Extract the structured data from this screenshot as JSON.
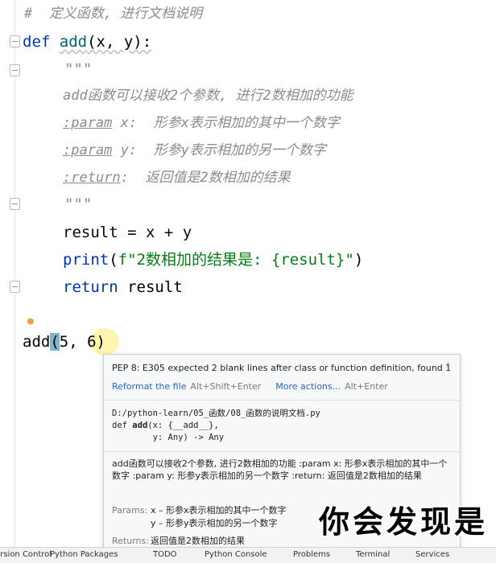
{
  "editor": {
    "comment": "#  定义函数, 进行文档说明",
    "def_kw": "def ",
    "func_name": "add",
    "def_params": "(x, y):",
    "doc_open": "\"\"\"",
    "doc_line1": "add函数可以接收2个参数, 进行2数相加的功能",
    "param_tag": ":param",
    "param_x": " x:  形参x表示相加的其中一个数字",
    "param_y": " y:  形参y表示相加的另一个数字",
    "return_tag": ":return",
    "return_text": ":  返回值是2数相加的结果",
    "doc_close": "\"\"\"",
    "body1": "result = x + y",
    "print_fn": "print",
    "print_open": "(",
    "print_str": "f\"2数相加的结果是: {result}\"",
    "print_close": ")",
    "return_kw": "return",
    "return_val": " result",
    "call_name": "add",
    "call_open": "(",
    "call_args": "5, 6",
    "call_close": ")"
  },
  "popup": {
    "warning": "PEP 8: E305 expected 2 blank lines after class or function definition, found 1",
    "reformat_label": "Reformat the file",
    "reformat_shortcut": "Alt+Shift+Enter",
    "more_label": "More actions...",
    "more_shortcut": "Alt+Enter",
    "path": "D:/python-learn/05_函数/08_函数的说明文档.py",
    "sig_def": "def ",
    "sig_name": "add",
    "sig_line1_rest": "(x: {__add__},",
    "sig_line2": "        y: Any) -> Any",
    "description": "add函数可以接收2个参数, 进行2数相加的功能 :param x: 形参x表示相加的其中一个数字 :param y: 形参y表示相加的另一个数字 :return: 返回值是2数相加的结果",
    "params_label": "Params:",
    "param_x_doc": "x – 形参x表示相加的其中一个数字",
    "param_y_doc": "y – 形参y表示相加的另一个数字",
    "returns_label": "Returns:",
    "returns_doc": "返回值是2数相加的结果"
  },
  "subtitle": "你会发现是",
  "statusbar": {
    "items": [
      "Version Control",
      "Python Packages",
      "TODO",
      "Python Console",
      "Problems",
      "Terminal",
      "Services"
    ]
  }
}
